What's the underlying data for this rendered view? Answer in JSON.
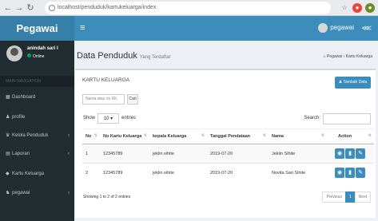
{
  "browser": {
    "url": "localhost/penduduk/kartukeluarga/index",
    "colors": {
      "chrome": "#e8eaed"
    }
  },
  "app": {
    "brand": "Pegawai",
    "user_name": "pegawai",
    "colors": {
      "primary": "#3c8dbc",
      "sidebar": "#222d32",
      "brand_bg": "#367fa9"
    }
  },
  "sidebar": {
    "user_name": "anindah sari l",
    "status": "Online",
    "header": "MAIN NAVIGATION",
    "items": [
      {
        "icon": "dashboard-icon",
        "label": "Dashboard"
      },
      {
        "icon": "user-icon",
        "label": "profile"
      },
      {
        "icon": "users-icon",
        "label": "Kelola Penduduk"
      },
      {
        "icon": "report-icon",
        "label": "Laporan"
      },
      {
        "icon": "family-card-icon",
        "label": "Kartu Keluarga"
      },
      {
        "icon": "group-icon",
        "label": "pegawai"
      }
    ]
  },
  "page": {
    "title": "Data Penduduk",
    "subtitle": "Yang Terdaftar",
    "breadcrumb": [
      "Pegawai",
      "Kartu Keluarga"
    ]
  },
  "box": {
    "title": "KARTU KELUARGA",
    "add_button": "Tambah Data",
    "search_placeholder": "Nama atau no KK",
    "search_button": "Cari"
  },
  "datatable": {
    "show_label": "Show",
    "entries_value": "10",
    "entries_label": "entries",
    "search_label": "Search:",
    "columns": [
      "No",
      "No Kartu Keluarga",
      "kepala Keluarga",
      "Tanggal Pendataan",
      "Nama",
      "Action"
    ],
    "rows": [
      {
        "no": "1",
        "kk": "12345789",
        "kepala": "jeklin sihite",
        "tanggal": "2019-07-20",
        "nama": "Jeklin Sihite"
      },
      {
        "no": "2",
        "kk": "12345789",
        "kepala": "jeklin sihite",
        "tanggal": "2019-07-20",
        "nama": "Novita Sari Sihite"
      }
    ],
    "info": "Showing 1 to 2 of 2 entries",
    "pagination": {
      "previous": "Previous",
      "current": "1",
      "next": "Next"
    }
  }
}
